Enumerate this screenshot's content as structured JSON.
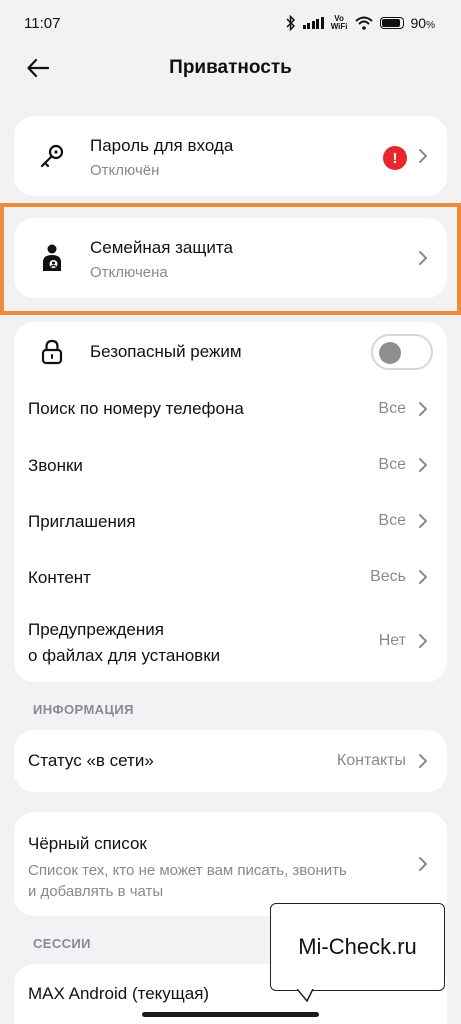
{
  "status_bar": {
    "time": "11:07",
    "network_label": "Vo\nWiFi",
    "battery_percent": "90",
    "battery_unit": "%",
    "battery_level": 0.9
  },
  "header": {
    "title": "Приватность",
    "back_icon": "arrow-left-icon"
  },
  "login_password": {
    "title": "Пароль для входа",
    "subtitle": "Отключён",
    "alert_glyph": "!",
    "icon": "key-icon"
  },
  "family_protection": {
    "title": "Семейная защита",
    "subtitle": "Отключена",
    "icon": "family-person-icon"
  },
  "settings": {
    "safe_mode": {
      "title": "Безопасный режим",
      "enabled": false,
      "icon": "lock-icon"
    },
    "phone_search": {
      "title": "Поиск по номеру телефона",
      "value": "Все"
    },
    "calls": {
      "title": "Звонки",
      "value": "Все"
    },
    "invitations": {
      "title": "Приглашения",
      "value": "Все"
    },
    "content": {
      "title": "Контент",
      "value": "Весь"
    },
    "install_warnings": {
      "title_line1": "Предупреждения",
      "title_line2": "о файлах для установки",
      "value": "Нет"
    }
  },
  "info_section": {
    "label": "ИНФОРМАЦИЯ",
    "online_status": {
      "title": "Статус «в сети»",
      "value": "Контакты"
    }
  },
  "blacklist": {
    "title": "Чёрный список",
    "subtitle_line1": "Список тех, кто не может вам писать, звонить",
    "subtitle_line2": "и добавлять в чаты"
  },
  "sessions_section": {
    "label": "СЕССИИ",
    "current_session": "MAX Android (текущая)"
  },
  "watermark": {
    "text": "Mi-Check.ru"
  },
  "colors": {
    "highlight": "#ef8c3c",
    "alert": "#e8262e",
    "background": "#f2f2f4"
  }
}
